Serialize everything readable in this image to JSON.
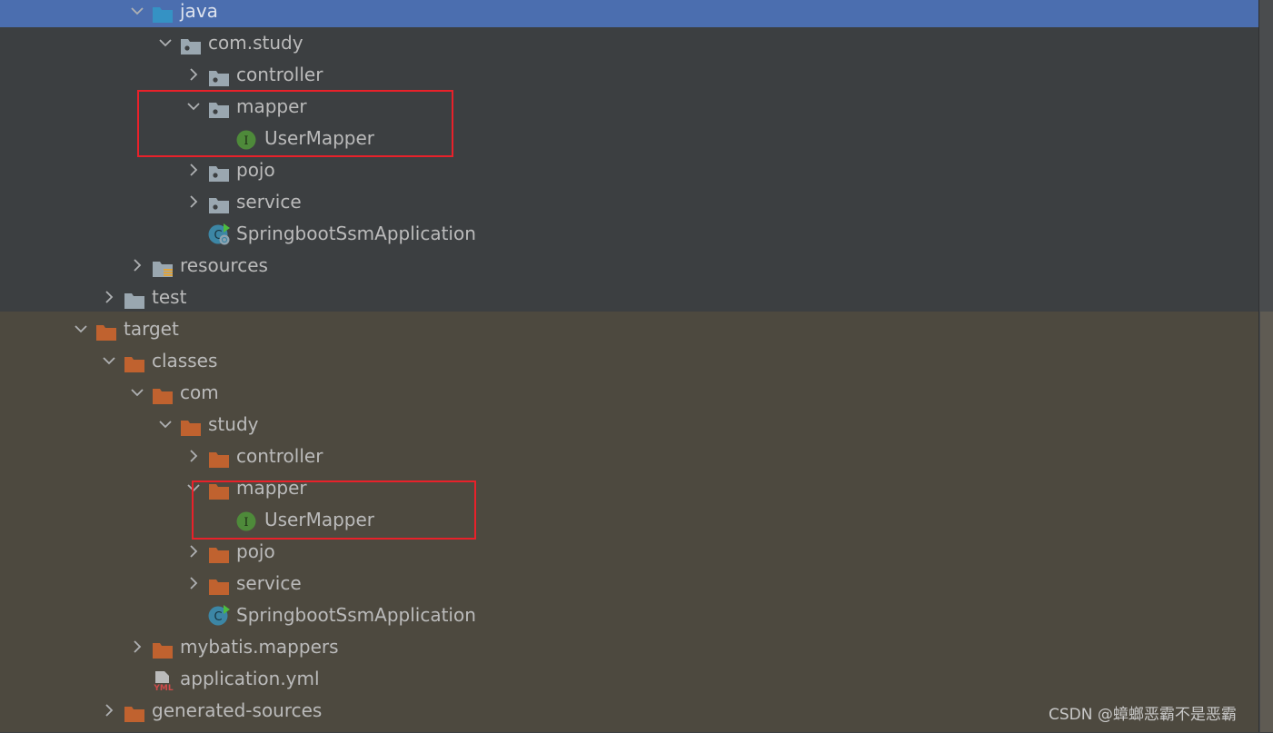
{
  "tree": [
    {
      "label": "java",
      "level": 2,
      "chevron": "down",
      "icon": "source-folder-icon",
      "selected": true
    },
    {
      "label": "com.study",
      "level": 3,
      "chevron": "down",
      "icon": "package-icon"
    },
    {
      "label": "controller",
      "level": 4,
      "chevron": "right",
      "icon": "package-icon"
    },
    {
      "label": "mapper",
      "level": 4,
      "chevron": "down",
      "icon": "package-icon"
    },
    {
      "label": "UserMapper",
      "level": 5,
      "chevron": "none",
      "icon": "interface-icon"
    },
    {
      "label": "pojo",
      "level": 4,
      "chevron": "right",
      "icon": "package-icon"
    },
    {
      "label": "service",
      "level": 4,
      "chevron": "right",
      "icon": "package-icon"
    },
    {
      "label": "SpringbootSsmApplication",
      "level": 4,
      "chevron": "none",
      "icon": "spring-boot-class-icon"
    },
    {
      "label": "resources",
      "level": 2,
      "chevron": "right",
      "icon": "resources-folder-icon"
    },
    {
      "label": "test",
      "level": 1,
      "chevron": "right",
      "icon": "folder-icon"
    },
    {
      "label": "target",
      "level": 0,
      "chevron": "down",
      "icon": "excluded-folder-icon"
    },
    {
      "label": "classes",
      "level": 1,
      "chevron": "down",
      "icon": "excluded-folder-icon"
    },
    {
      "label": "com",
      "level": 2,
      "chevron": "down",
      "icon": "excluded-folder-icon"
    },
    {
      "label": "study",
      "level": 3,
      "chevron": "down",
      "icon": "excluded-folder-icon"
    },
    {
      "label": "controller",
      "level": 4,
      "chevron": "right",
      "icon": "excluded-folder-icon"
    },
    {
      "label": "mapper",
      "level": 4,
      "chevron": "down",
      "icon": "excluded-folder-icon"
    },
    {
      "label": "UserMapper",
      "level": 5,
      "chevron": "none",
      "icon": "interface-icon"
    },
    {
      "label": "pojo",
      "level": 4,
      "chevron": "right",
      "icon": "excluded-folder-icon"
    },
    {
      "label": "service",
      "level": 4,
      "chevron": "right",
      "icon": "excluded-folder-icon"
    },
    {
      "label": "SpringbootSsmApplication",
      "level": 4,
      "chevron": "none",
      "icon": "class-icon"
    },
    {
      "label": "mybatis.mappers",
      "level": 2,
      "chevron": "right",
      "icon": "excluded-folder-icon"
    },
    {
      "label": "application.yml",
      "level": 2,
      "chevron": "none",
      "icon": "yml-file-icon"
    },
    {
      "label": "generated-sources",
      "level": 1,
      "chevron": "right",
      "icon": "excluded-folder-icon"
    }
  ],
  "colors": {
    "selection": "#4b6eaf",
    "highlight_box": "#e8212a",
    "excluded_folder": "#c0622f",
    "package": "#9aa7b0",
    "interface": "#4e8a3a"
  },
  "watermark": "CSDN @蟑螂恶霸不是恶霸",
  "yml_badge": "YML",
  "interface_letter": "I",
  "class_letter": "C"
}
